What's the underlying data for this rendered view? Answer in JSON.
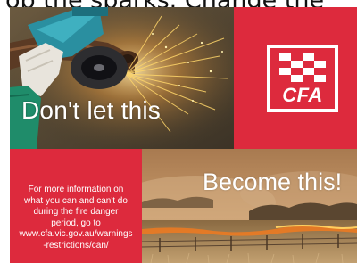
{
  "header": {
    "partial_text": "op the sparks. Change the"
  },
  "panels": {
    "grinder_photo": {
      "caption": "Don't let this",
      "image_icon": "angle-grinder-sparks-photo"
    },
    "logo_panel": {
      "logo_text": "CFA",
      "logo_icon": "cfa-chequered-logo",
      "background_color": "#dd2a3d"
    },
    "info_panel": {
      "lines": [
        "For more information on",
        "what you can and can't do",
        "during the fire danger",
        "period, go to",
        "www.cfa.vic.gov.au/warnings",
        "-restrictions/can/"
      ],
      "background_color": "#dd2a3d"
    },
    "fire_photo": {
      "caption": "Become this!",
      "image_icon": "grass-fire-photo"
    }
  },
  "colors": {
    "accent": "#dd2a3d",
    "text_light": "#ffffff"
  }
}
